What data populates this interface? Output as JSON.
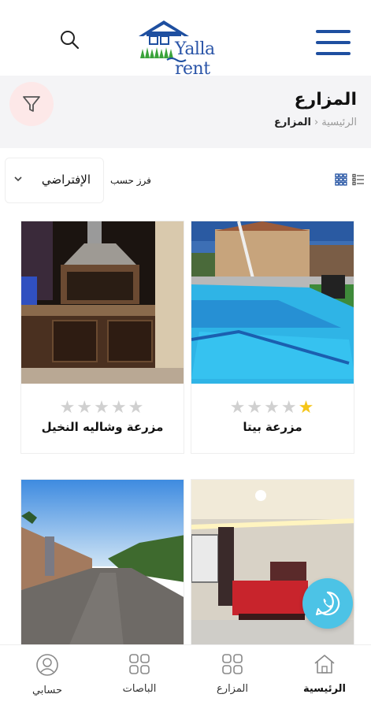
{
  "header": {
    "logo_text": "Yalla rent",
    "brand_color": "#1e4fa0"
  },
  "page": {
    "title": "المزارع",
    "breadcrumb": {
      "home": "الرئيسية",
      "separator": "›",
      "current": "المزارع"
    }
  },
  "sort": {
    "label": "فرز حسب",
    "value": "الإفتراضي"
  },
  "listings": [
    {
      "name": "مزرعة بيتا",
      "rating": 1,
      "max_rating": 5
    },
    {
      "name": "مزرعة وشاليه النخيل",
      "rating": 0,
      "max_rating": 5
    }
  ],
  "bottom_nav": {
    "items": [
      {
        "label": "الرئيسية",
        "icon": "home-icon"
      },
      {
        "label": "المزارع",
        "icon": "grid-icon"
      },
      {
        "label": "الباصات",
        "icon": "grid-icon"
      },
      {
        "label": "حسابي",
        "icon": "user-icon"
      }
    ]
  },
  "colors": {
    "accent": "#1e4fa0",
    "star": "#f5c518",
    "whatsapp": "#4cc3e6",
    "filter_bg": "#fde8e8"
  }
}
